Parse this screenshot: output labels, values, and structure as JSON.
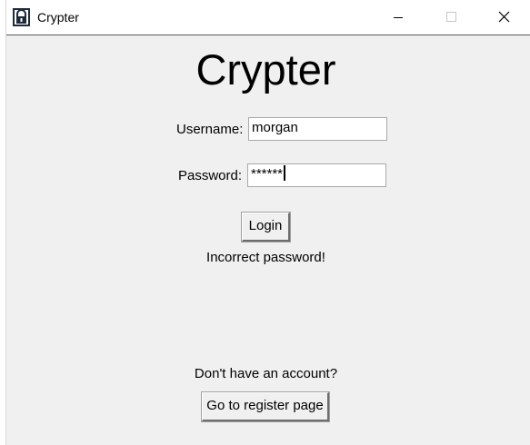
{
  "window": {
    "title": "Crypter",
    "icon": "crypter-app-icon",
    "controls": [
      "minimize-icon",
      "maximize-icon",
      "close-icon"
    ]
  },
  "main": {
    "heading": "Crypter",
    "username_label": "Username:",
    "username_value": "morgan",
    "password_label": "Password:",
    "password_value": "******",
    "login_label": "Login",
    "status_message": "Incorrect password!",
    "register_prompt": "Don't have an account?",
    "register_label": "Go to register page"
  },
  "colors": {
    "window_background": "#f0f0f0",
    "titlebar_background": "#ffffff",
    "field_background": "#ffffff"
  }
}
